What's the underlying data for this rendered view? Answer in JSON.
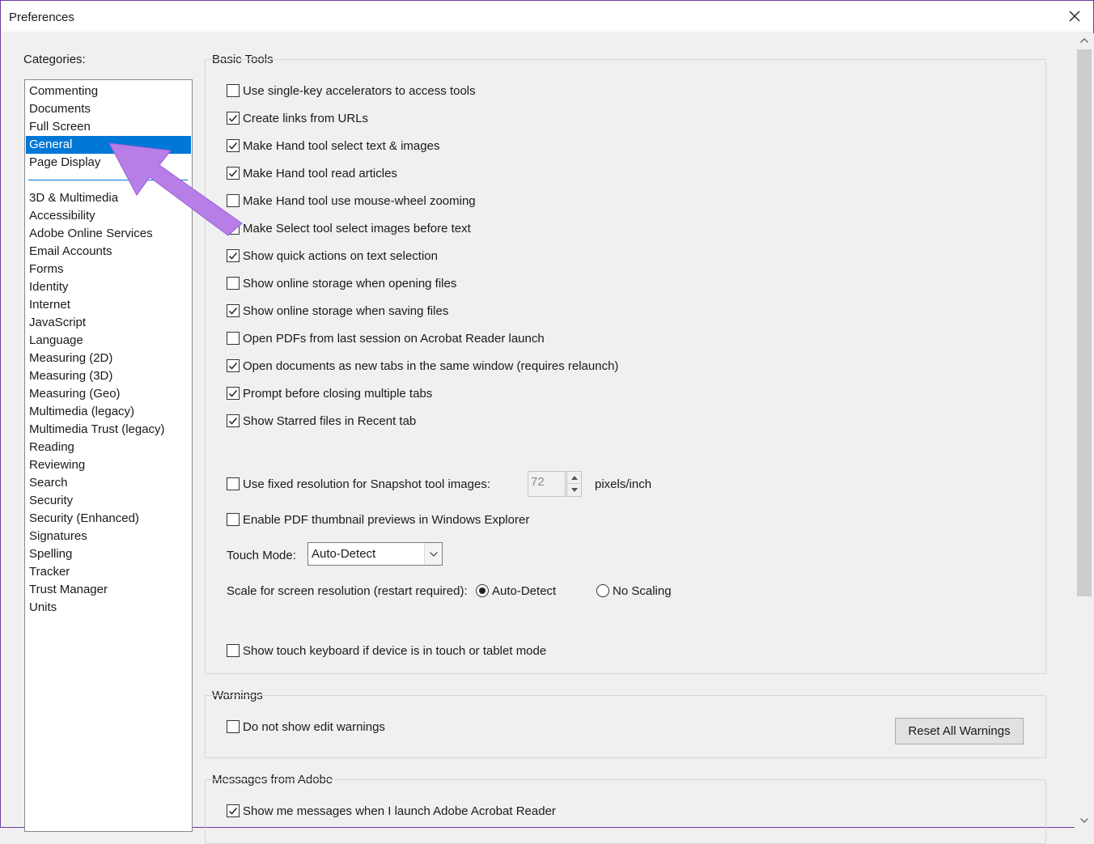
{
  "window": {
    "title": "Preferences"
  },
  "categories": {
    "label": "Categories:",
    "group1": [
      "Commenting",
      "Documents",
      "Full Screen",
      "General",
      "Page Display"
    ],
    "group2": [
      "3D & Multimedia",
      "Accessibility",
      "Adobe Online Services",
      "Email Accounts",
      "Forms",
      "Identity",
      "Internet",
      "JavaScript",
      "Language",
      "Measuring (2D)",
      "Measuring (3D)",
      "Measuring (Geo)",
      "Multimedia (legacy)",
      "Multimedia Trust (legacy)",
      "Reading",
      "Reviewing",
      "Search",
      "Security",
      "Security (Enhanced)",
      "Signatures",
      "Spelling",
      "Tracker",
      "Trust Manager",
      "Units"
    ],
    "selected": "General"
  },
  "basic_tools": {
    "title": "Basic Tools",
    "options": [
      {
        "label": "Use single-key accelerators to access tools",
        "checked": false
      },
      {
        "label": "Create links from URLs",
        "checked": true
      },
      {
        "label": "Make Hand tool select text & images",
        "checked": true
      },
      {
        "label": "Make Hand tool read articles",
        "checked": true
      },
      {
        "label": "Make Hand tool use mouse-wheel zooming",
        "checked": false
      },
      {
        "label": "Make Select tool select images before text",
        "checked": false
      },
      {
        "label": "Show quick actions on text selection",
        "checked": true
      },
      {
        "label": "Show online storage when opening files",
        "checked": false
      },
      {
        "label": "Show online storage when saving files",
        "checked": true
      },
      {
        "label": "Open PDFs from last session on Acrobat Reader launch",
        "checked": false
      },
      {
        "label": "Open documents as new tabs in the same window (requires relaunch)",
        "checked": true
      },
      {
        "label": "Prompt before closing multiple tabs",
        "checked": true
      },
      {
        "label": "Show Starred files in Recent tab",
        "checked": true
      }
    ],
    "snapshot": {
      "label": "Use fixed resolution for Snapshot tool images:",
      "checked": false,
      "value": "72",
      "unit": "pixels/inch"
    },
    "thumbnail": {
      "label": "Enable PDF thumbnail previews in Windows Explorer",
      "checked": false
    },
    "touch_mode": {
      "label": "Touch Mode:",
      "value": "Auto-Detect"
    },
    "scale": {
      "label": "Scale for screen resolution (restart required):",
      "options": [
        "Auto-Detect",
        "No Scaling"
      ],
      "selected": "Auto-Detect"
    },
    "touch_keyboard": {
      "label": "Show touch keyboard if device is in touch or tablet mode",
      "checked": false
    }
  },
  "warnings": {
    "title": "Warnings",
    "option": {
      "label": "Do not show edit warnings",
      "checked": false
    },
    "reset_button": "Reset All Warnings"
  },
  "messages": {
    "title": "Messages from Adobe",
    "option": {
      "label": "Show me messages when I launch Adobe Acrobat Reader",
      "checked": true
    }
  },
  "colors": {
    "selection": "#0078d7",
    "annotation_arrow": "#b77ee8"
  },
  "icons": {
    "close": "close-icon",
    "check": "checkmark-icon",
    "dropdown": "chevron-down-icon"
  }
}
